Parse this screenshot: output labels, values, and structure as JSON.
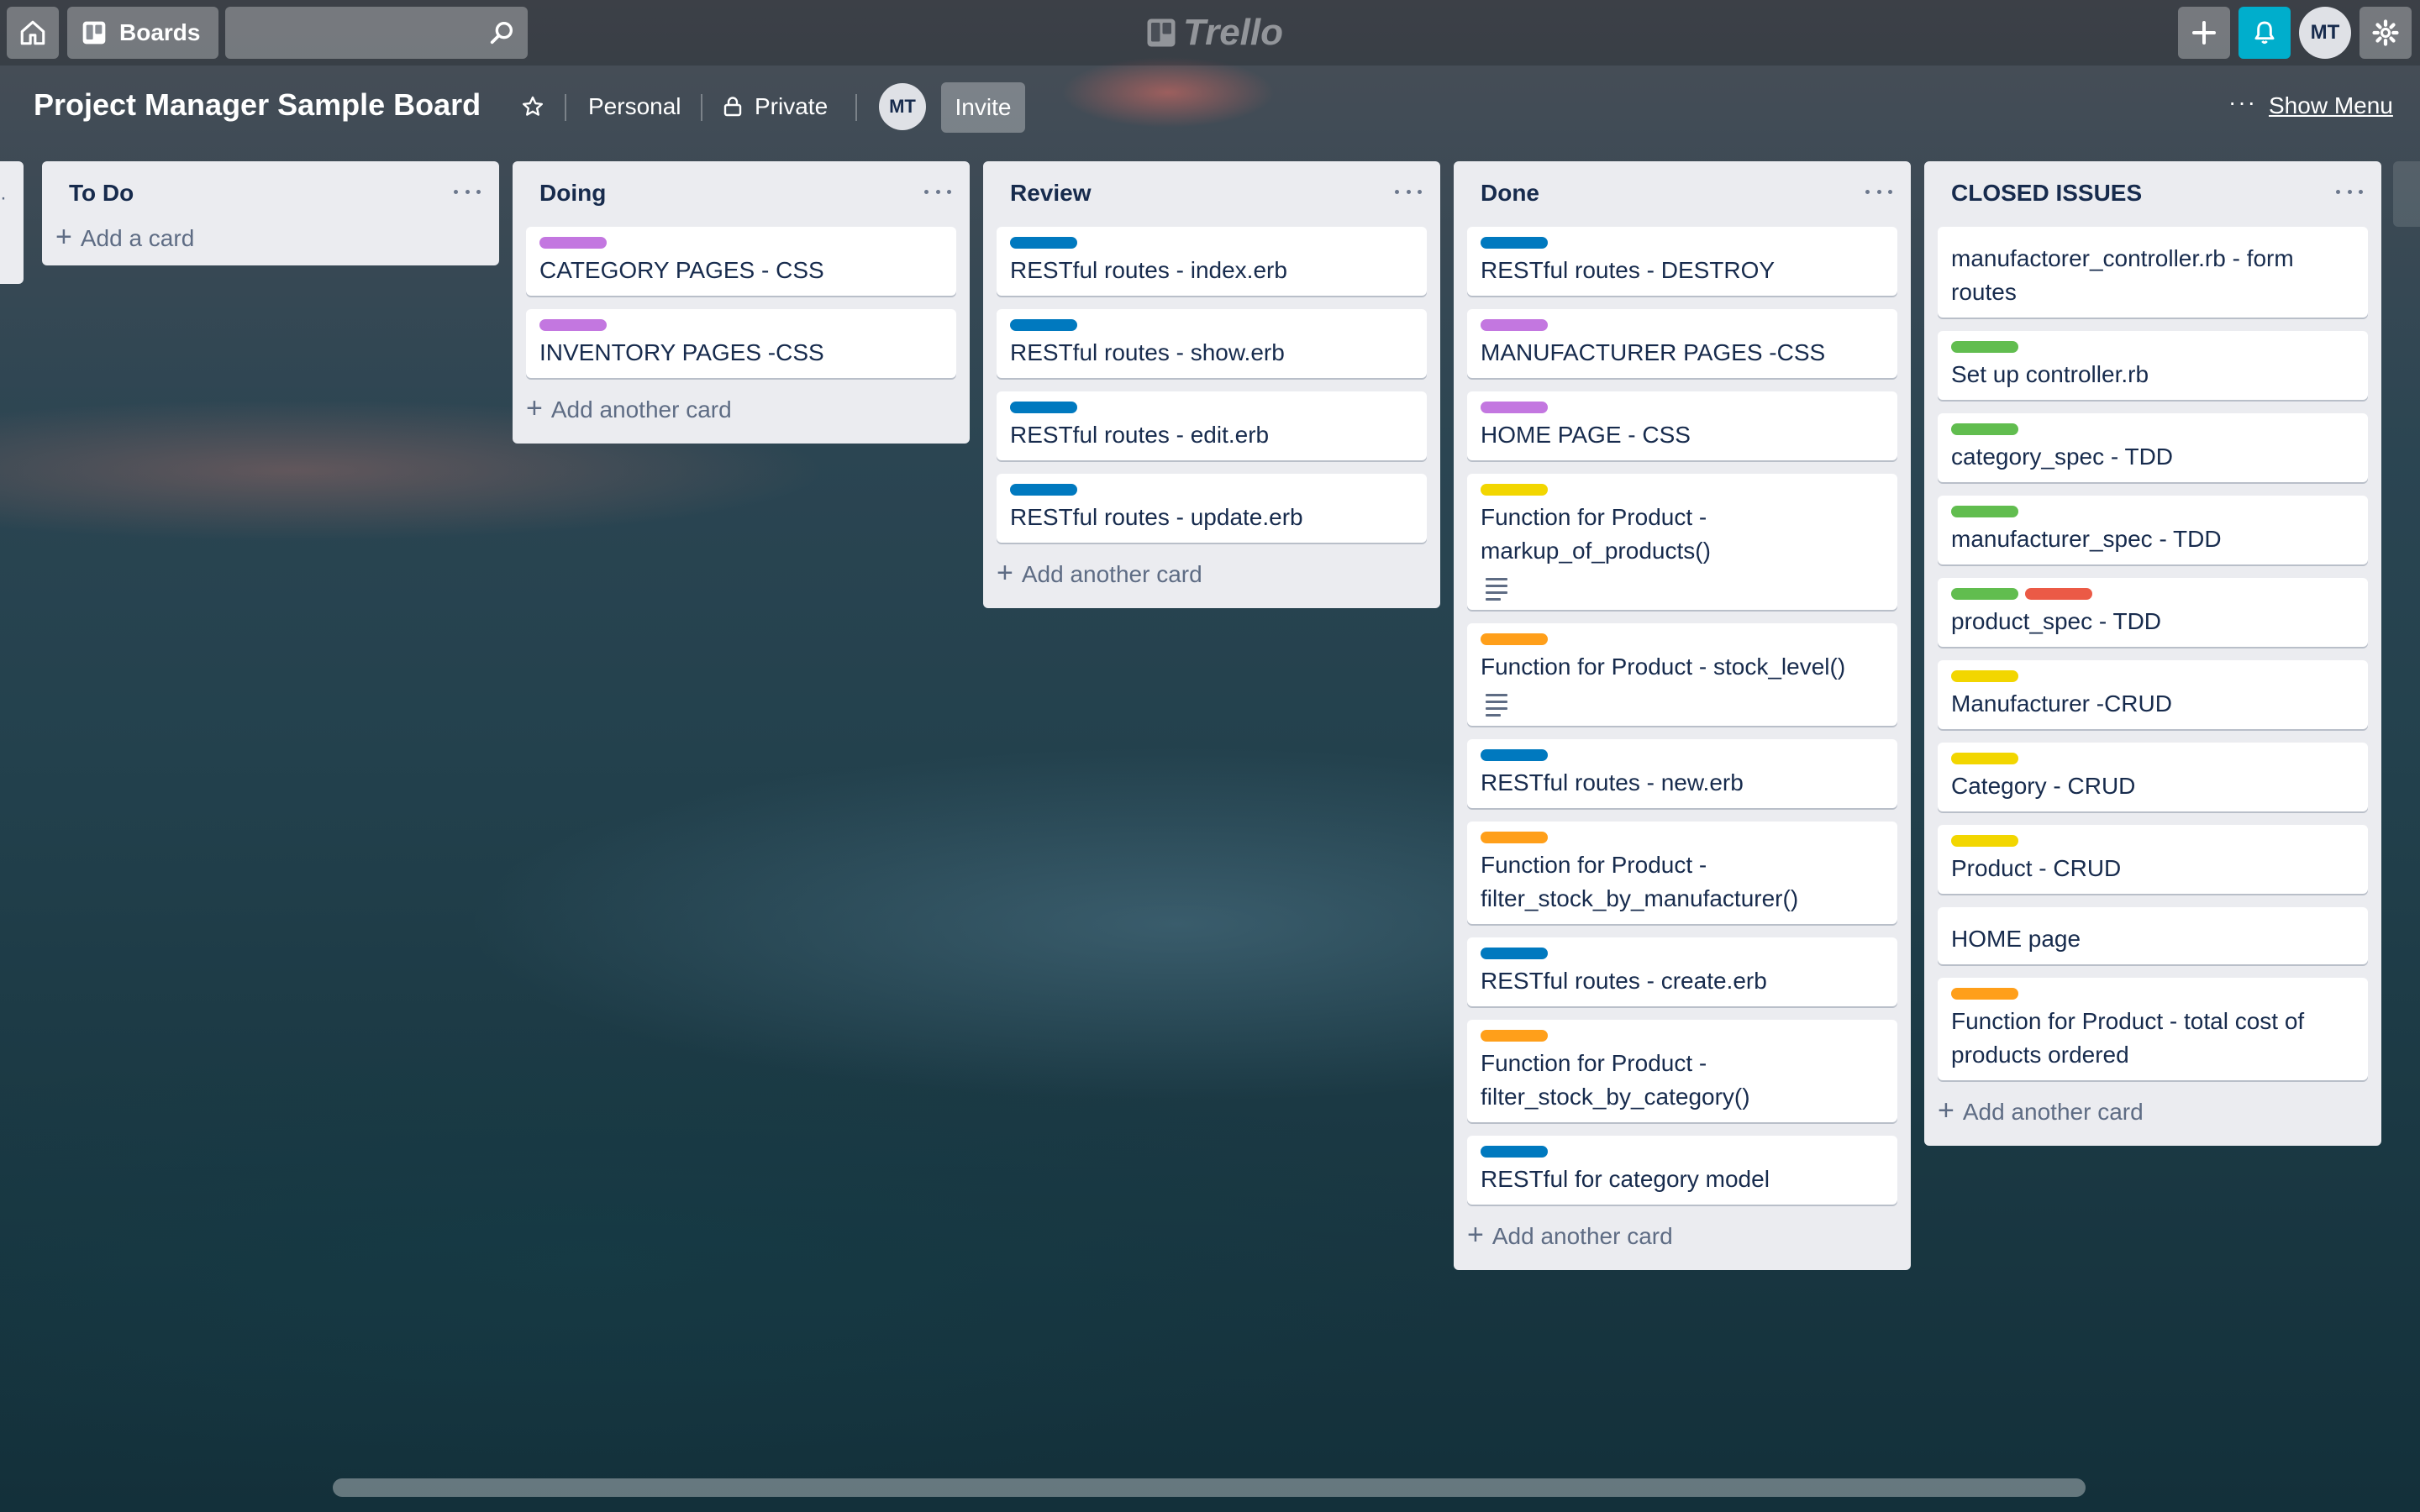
{
  "header": {
    "boards_label": "Boards",
    "search_placeholder": "",
    "logo_text": "Trello",
    "avatar_initials": "MT"
  },
  "board": {
    "title": "Project Manager Sample Board",
    "team": "Personal",
    "visibility": "Private",
    "member_initials": "MT",
    "invite_label": "Invite",
    "more_label": "···",
    "show_menu_label": "Show Menu"
  },
  "label_colors": {
    "purple": "#c377e0",
    "blue": "#0079bf",
    "yellow": "#f2d600",
    "orange": "#ff9f1a",
    "green": "#61bd4f",
    "red": "#eb5a46"
  },
  "lists": [
    {
      "title": "To Do",
      "cards": [],
      "add_label": "Add a card"
    },
    {
      "title": "Doing",
      "cards": [
        {
          "text": "CATEGORY PAGES - CSS",
          "labels": [
            "purple"
          ]
        },
        {
          "text": "INVENTORY PAGES -CSS",
          "labels": [
            "purple"
          ]
        }
      ],
      "add_label": "Add another card"
    },
    {
      "title": "Review",
      "cards": [
        {
          "text": "RESTful routes - index.erb",
          "labels": [
            "blue"
          ]
        },
        {
          "text": "RESTful routes - show.erb",
          "labels": [
            "blue"
          ]
        },
        {
          "text": "RESTful routes - edit.erb",
          "labels": [
            "blue"
          ]
        },
        {
          "text": "RESTful routes - update.erb",
          "labels": [
            "blue"
          ]
        }
      ],
      "add_label": "Add another card"
    },
    {
      "title": "Done",
      "cards": [
        {
          "text": "RESTful routes - DESTROY",
          "labels": [
            "blue"
          ]
        },
        {
          "text": "MANUFACTURER PAGES -CSS",
          "labels": [
            "purple"
          ]
        },
        {
          "text": "HOME PAGE - CSS",
          "labels": [
            "purple"
          ]
        },
        {
          "text": "Function for Product - markup_of_products()",
          "labels": [
            "yellow"
          ],
          "has_description": true
        },
        {
          "text": "Function for Product - stock_level()",
          "labels": [
            "orange"
          ],
          "has_description": true
        },
        {
          "text": "RESTful routes - new.erb",
          "labels": [
            "blue"
          ]
        },
        {
          "text": "Function for Product - filter_stock_by_manufacturer()",
          "labels": [
            "orange"
          ]
        },
        {
          "text": "RESTful routes - create.erb",
          "labels": [
            "blue"
          ]
        },
        {
          "text": "Function for Product - filter_stock_by_category()",
          "labels": [
            "orange"
          ]
        },
        {
          "text": "RESTful for category model",
          "labels": [
            "blue"
          ]
        }
      ],
      "add_label": "Add another card"
    },
    {
      "title": "CLOSED ISSUES",
      "cards": [
        {
          "text": "manufactorer_controller.rb - form routes",
          "labels": []
        },
        {
          "text": "Set up controller.rb",
          "labels": [
            "green"
          ]
        },
        {
          "text": "category_spec - TDD",
          "labels": [
            "green"
          ]
        },
        {
          "text": "manufacturer_spec - TDD",
          "labels": [
            "green"
          ]
        },
        {
          "text": "product_spec - TDD",
          "labels": [
            "green",
            "red"
          ]
        },
        {
          "text": "Manufacturer -CRUD",
          "labels": [
            "yellow"
          ]
        },
        {
          "text": "Category - CRUD",
          "labels": [
            "yellow"
          ]
        },
        {
          "text": "Product - CRUD",
          "labels": [
            "yellow"
          ]
        },
        {
          "text": "HOME page",
          "labels": []
        },
        {
          "text": "Function for Product - total cost of products ordered",
          "labels": [
            "orange"
          ]
        }
      ],
      "add_label": "Add another card"
    }
  ]
}
